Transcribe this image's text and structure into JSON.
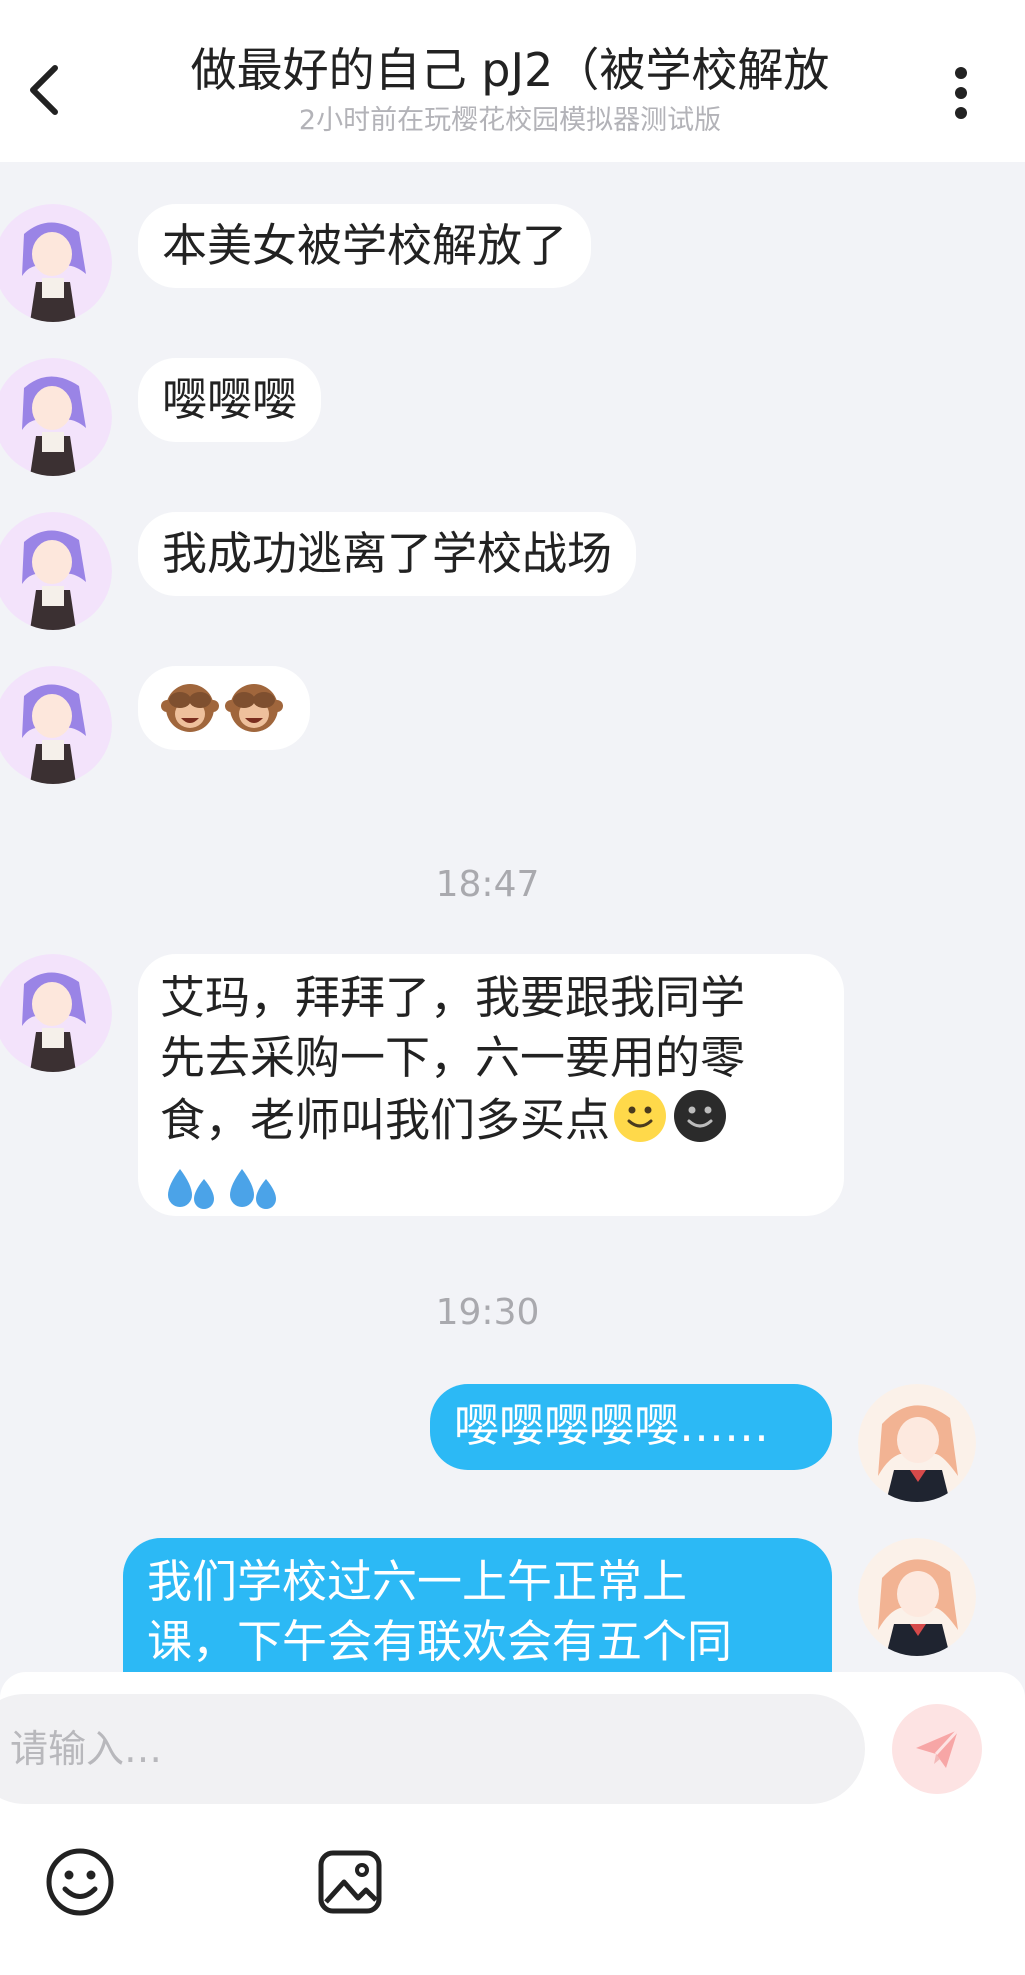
{
  "header": {
    "title": "做最好的自己 pJ2（被学校解放",
    "subtitle": "2小时前在玩樱花校园模拟器测试版"
  },
  "messages": [
    {
      "side": "left",
      "text": "本美女被学校解放了"
    },
    {
      "side": "left",
      "text": "嘤嘤嘤"
    },
    {
      "side": "left",
      "text": "我成功逃离了学校战场"
    },
    {
      "side": "left",
      "emojis": [
        "see-no-evil-monkey",
        "see-no-evil-monkey"
      ]
    },
    {
      "type": "time",
      "text": "18:47"
    },
    {
      "side": "left",
      "lines": [
        "艾玛，拜拜了，我要跟我同学",
        "先去采购一下，六一要用的零",
        "食，老师叫我们多买点"
      ],
      "emojis": [
        "slightly-smiling-face",
        "dark-smiling-face",
        "sweat-droplets",
        "sweat-droplets"
      ]
    },
    {
      "type": "time",
      "text": "19:30"
    },
    {
      "side": "right",
      "text": "嘤嘤嘤嘤嘤……"
    },
    {
      "side": "right",
      "lines": [
        "我们学校过六一上午正常上",
        "课，下午会有联欢会有五个同"
      ]
    }
  ],
  "input": {
    "placeholder": "请输入…"
  },
  "icons": {
    "back": "chevron-left-icon",
    "more": "more-vertical-icon",
    "send": "paper-plane-icon",
    "emoji": "smiley-icon",
    "image": "image-icon"
  },
  "colors": {
    "self_bubble": "#2cb9f5",
    "other_bubble": "#ffffff",
    "background": "#f2f3f7",
    "send_button": "#fde3e3",
    "send_icon": "#f7a6a6"
  }
}
